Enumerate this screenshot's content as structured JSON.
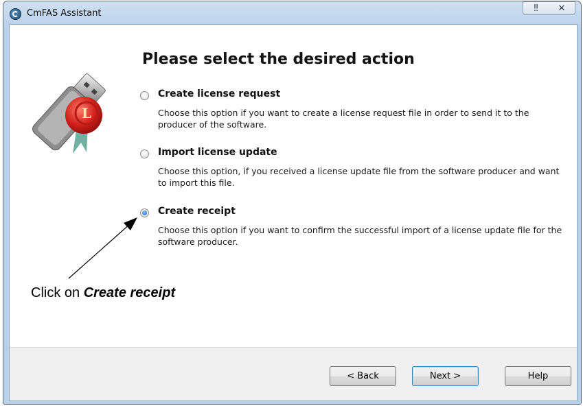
{
  "window": {
    "title": "CmFAS Assistant",
    "help_icon": "question-mark-icon",
    "close_icon": "close-icon"
  },
  "main": {
    "heading": "Please select the desired action",
    "options": [
      {
        "label": "Create license request",
        "description": "Choose this option if you want to create a license request file in order to send it to the producer of the software.",
        "selected": false
      },
      {
        "label": "Import license update",
        "description": "Choose this option, if you received a license update file from the software producer and want to import this file.",
        "selected": false
      },
      {
        "label": "Create receipt",
        "description": "Choose this option if you want to confirm the successful import of a license update file for the software producer.",
        "selected": true
      }
    ]
  },
  "annotation": {
    "prefix": "Click on ",
    "emphasis": "Create receipt"
  },
  "footer": {
    "back_label": "< Back",
    "next_label": "Next >",
    "help_label": "Help"
  },
  "colors": {
    "titlebar": "#c4d8ee",
    "accent_radio": "#1d63b6",
    "footer_bg": "#f0f0f0"
  }
}
